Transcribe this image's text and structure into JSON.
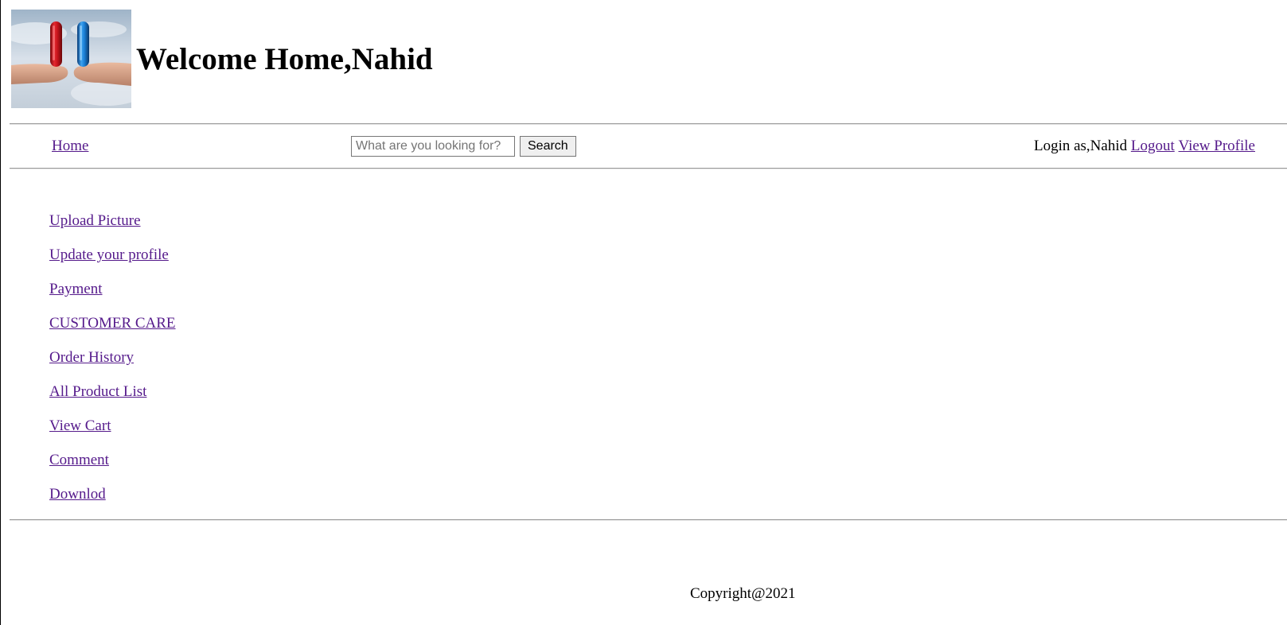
{
  "header": {
    "welcome_title": "Welcome Home,Nahid",
    "logo_icon": "pill-capsules-logo"
  },
  "nav": {
    "home_label": "Home",
    "search": {
      "placeholder": "What are you looking for?",
      "value": "",
      "button_label": "Search"
    },
    "login_text": "Login as,Nahid",
    "logout_label": "Logout",
    "view_profile_label": "View Profile"
  },
  "menu": {
    "items": [
      {
        "label": "Upload Picture"
      },
      {
        "label": "Update your profile"
      },
      {
        "label": "Payment"
      },
      {
        "label": "CUSTOMER CARE"
      },
      {
        "label": "Order History"
      },
      {
        "label": "All Product List"
      },
      {
        "label": "View Cart"
      },
      {
        "label": "Comment"
      },
      {
        "label": "Downlod"
      }
    ]
  },
  "footer": {
    "copyright": "Copyright@2021"
  },
  "colors": {
    "link": "#551a8b",
    "rule": "#9a9a9a",
    "capsule_red": "#c8141c",
    "capsule_blue": "#1a7fd6"
  }
}
